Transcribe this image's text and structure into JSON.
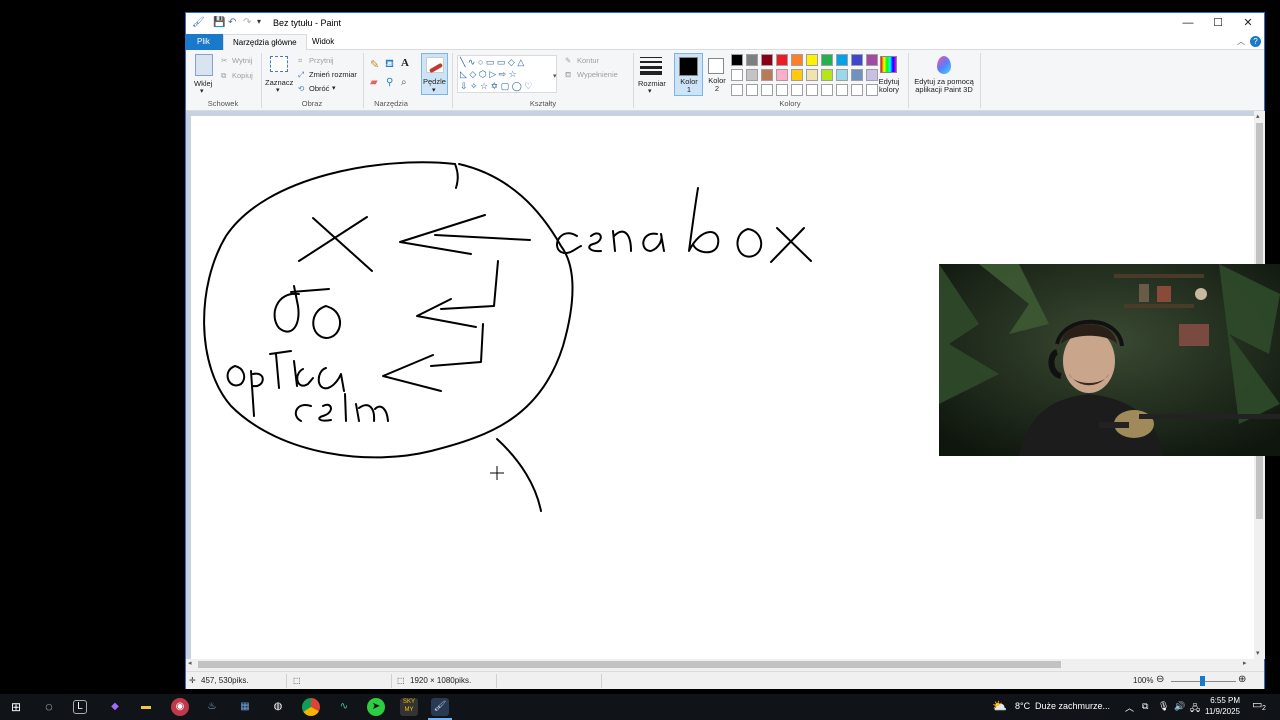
{
  "window": {
    "title": "Bez tytułu - Paint",
    "minimize": "—",
    "maximize": "☐",
    "close": "✕"
  },
  "tabs": {
    "file": "Plik",
    "home": "Narzędzia główne",
    "view": "Widok"
  },
  "ribbon": {
    "clipboard": {
      "group": "Schowek",
      "paste": "Wklej",
      "cut": "Wytnij",
      "copy": "Kopiuj"
    },
    "image": {
      "group": "Obraz",
      "select": "Zaznacz",
      "crop": "Przytnij",
      "resize": "Zmień rozmiar",
      "rotate": "Obróć"
    },
    "tools": {
      "group": "Narzędzia",
      "text_tool": "A"
    },
    "brushes": {
      "label": "Pędzle"
    },
    "shapes": {
      "group": "Kształty",
      "outline": "Kontur",
      "fill": "Wypełnienie"
    },
    "size": {
      "label": "Rozmiar"
    },
    "colors": {
      "group": "Kolory",
      "color1": "Kolor 1",
      "color2": "Kolor 2",
      "edit": "Edytuj kolory",
      "paint3d": "Edytuj za pomocą aplikacji Paint 3D",
      "color1_value": "#000000",
      "color2_value": "#ffffff",
      "palette_row1": [
        "#000000",
        "#7f7f7f",
        "#880015",
        "#ed1c24",
        "#ff7f27",
        "#fff200",
        "#22b14c",
        "#00a2e8",
        "#3f48cc",
        "#a349a4"
      ],
      "palette_row2": [
        "#ffffff",
        "#c3c3c3",
        "#b97a57",
        "#ffaec9",
        "#ffc90e",
        "#efe4b0",
        "#b5e61d",
        "#99d9ea",
        "#7092be",
        "#c8bfe7"
      ]
    }
  },
  "status": {
    "cursor_pos": "457, 530piks.",
    "image_size": "1920 × 1080piks.",
    "zoom": "100%"
  },
  "taskbar": {
    "weather_temp": "8°C",
    "weather_text": "Duże zachmurze...",
    "time": "6:55 PM",
    "date": "11/9/2025",
    "notifications": "2"
  }
}
